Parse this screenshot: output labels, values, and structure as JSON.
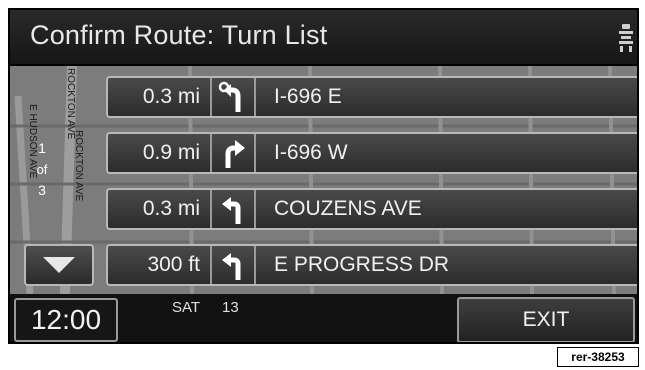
{
  "header": {
    "title": "Confirm Route: Turn List",
    "view_icon": "map-view-icon"
  },
  "map": {
    "street_labels": [
      "ROCKTON AVE",
      "E HUDSON AVE",
      "ROCKTON AVE"
    ],
    "counter": {
      "current": "1",
      "of_label": "of",
      "total": "3"
    }
  },
  "turns": [
    {
      "distance": "0.3 mi",
      "icon": "keep-left-roundabout-icon",
      "street": "I-696 E"
    },
    {
      "distance": "0.9 mi",
      "icon": "turn-right-icon",
      "street": "I-696 W"
    },
    {
      "distance": "0.3 mi",
      "icon": "turn-left-icon",
      "street": "COUZENS AVE"
    },
    {
      "distance": "300 ft",
      "icon": "turn-left-icon",
      "street": "E PROGRESS DR"
    }
  ],
  "scroll": {
    "icon": "triangle-down-icon"
  },
  "footer": {
    "clock": "12:00",
    "day": "SAT",
    "date": "13",
    "exit_label": "EXIT"
  },
  "reference_code": "rer-38253",
  "colors": {
    "screen_bg": "#0d0d0d",
    "map_bg": "#808080",
    "button_border": "#b8b8b8",
    "text": "#f0f0f0"
  }
}
